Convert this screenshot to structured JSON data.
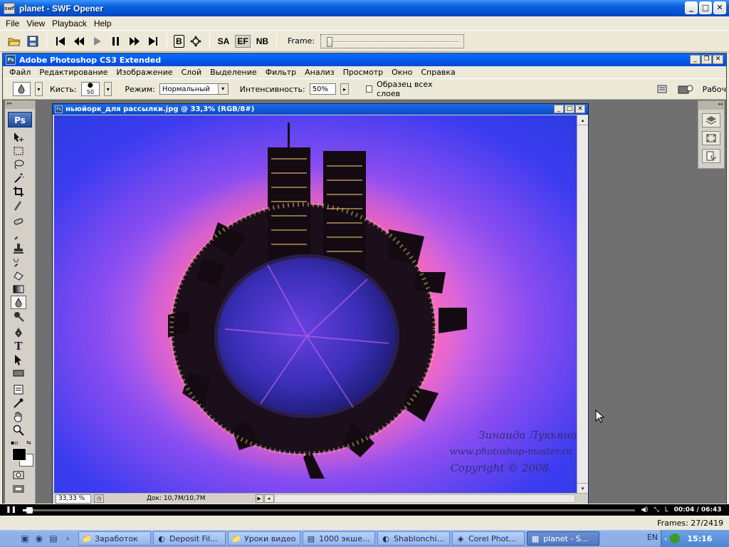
{
  "window": {
    "title": "planet - SWF Opener",
    "icon_text": "swf"
  },
  "swf_menu": [
    "File",
    "View",
    "Playback",
    "Help"
  ],
  "swf_toolbar": {
    "labels": [
      "B",
      "SA",
      "EF",
      "NB"
    ],
    "frame_label": "Frame:",
    "frame_slider_fraction": 0.011
  },
  "ps": {
    "title": "Adobe Photoshop CS3 Extended",
    "menu": [
      "Файл",
      "Редактирование",
      "Изображение",
      "Слой",
      "Выделение",
      "Фильтр",
      "Анализ",
      "Просмотр",
      "Окно",
      "Справка"
    ],
    "options": {
      "brush_label": "Кисть:",
      "brush_size": "50",
      "mode_label": "Режим:",
      "mode_value": "Нормальный",
      "intensity_label": "Интенсивность:",
      "intensity_value": "50%",
      "sample_all_label": "Образец всех слоев",
      "workspace_label": "Рабоч"
    },
    "logo": "Ps",
    "tools": [
      "move",
      "marquee",
      "lasso",
      "magic-wand",
      "crop",
      "slice",
      "healing",
      "brush",
      "stamp",
      "history-brush",
      "eraser",
      "gradient",
      "blur",
      "dodge",
      "pen",
      "type",
      "path-select",
      "shape",
      "notes",
      "eyedropper",
      "hand",
      "zoom"
    ],
    "type_tool_glyph": "T"
  },
  "doc": {
    "title": "ньюйорк_для рассылки.jpg @ 33,3% (RGB/8#)",
    "zoom": "33,33 %",
    "doc_size": "Док: 10,7M/10,7M",
    "watermark": {
      "line1": "Зинаида  Лукьянова",
      "line2": "www.photoshop-master.ru",
      "line3": "Copyright © 2008"
    }
  },
  "playback": {
    "current_time": "00:04",
    "total_time": "06:43",
    "time_sep": " / ",
    "progress_fraction": 0.011,
    "l_label": "L"
  },
  "status": {
    "frames_label": "Frames:",
    "frames_value": "27/2419"
  },
  "taskbar": {
    "items": [
      {
        "label": "Заработок",
        "icon": "folder-icon"
      },
      {
        "label": "Deposit Fil...",
        "icon": "firefox-icon"
      },
      {
        "label": "Уроки видео",
        "icon": "folder-icon"
      },
      {
        "label": "1000 экше...",
        "icon": "document-icon"
      },
      {
        "label": "Shablonchi...",
        "icon": "firefox-icon"
      },
      {
        "label": "Corel Phot...",
        "icon": "corel-icon"
      },
      {
        "label": "planet - S...",
        "icon": "swf-icon",
        "active": true
      }
    ],
    "lang": "EN",
    "clock": "15:16"
  }
}
